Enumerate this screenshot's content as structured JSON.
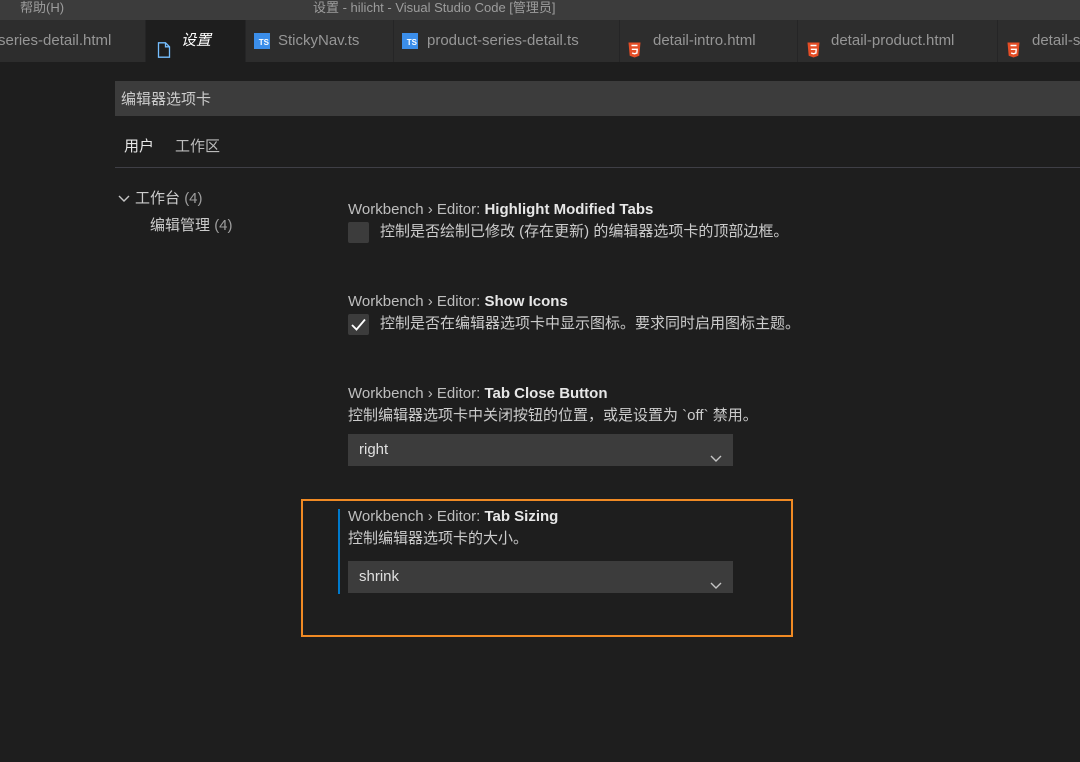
{
  "titlebar": {
    "menu_item": "帮助(H)",
    "window_title": "设置 - hilicht - Visual Studio Code [管理员]"
  },
  "tabs": [
    {
      "label": "series-detail.html",
      "icon": "none",
      "active": false
    },
    {
      "label": "设置",
      "icon": "file-icon",
      "active": true
    },
    {
      "label": "StickyNav.ts",
      "icon": "typescript-icon",
      "active": false
    },
    {
      "label": "product-series-detail.ts",
      "icon": "typescript-icon",
      "active": false
    },
    {
      "label": "detail-intro.html",
      "icon": "html5-icon",
      "active": false
    },
    {
      "label": "detail-product.html",
      "icon": "html5-icon",
      "active": false
    },
    {
      "label": "detail-s",
      "icon": "html5-icon",
      "active": false
    }
  ],
  "ts_badge_text": "TS",
  "search": {
    "value": "编辑器选项卡"
  },
  "scope_tabs": {
    "user": "用户",
    "workspace": "工作区"
  },
  "tree": {
    "group_label": "工作台",
    "group_count": "(4)",
    "child_label": "编辑管理",
    "child_count": "(4)"
  },
  "settings": [
    {
      "category": "Workbench › Editor: ",
      "name": "Highlight Modified Tabs",
      "description": "控制是否绘制已修改 (存在更新) 的编辑器选项卡的顶部边框。",
      "type": "checkbox",
      "checked": false
    },
    {
      "category": "Workbench › Editor: ",
      "name": "Show Icons",
      "description": "控制是否在编辑器选项卡中显示图标。要求同时启用图标主题。",
      "type": "checkbox",
      "checked": true
    },
    {
      "category": "Workbench › Editor: ",
      "name": "Tab Close Button",
      "description": "控制编辑器选项卡中关闭按钮的位置，或是设置为 `off` 禁用。",
      "type": "select",
      "value": "right"
    },
    {
      "category": "Workbench › Editor: ",
      "name": "Tab Sizing",
      "description": "控制编辑器选项卡的大小。",
      "type": "select",
      "value": "shrink"
    }
  ],
  "colors": {
    "background": "#1e1e1e",
    "accent": "#007acc",
    "highlight_box": "#f08a24",
    "ts_icon": "#3b8eea",
    "html_icon": "#e44d26"
  }
}
